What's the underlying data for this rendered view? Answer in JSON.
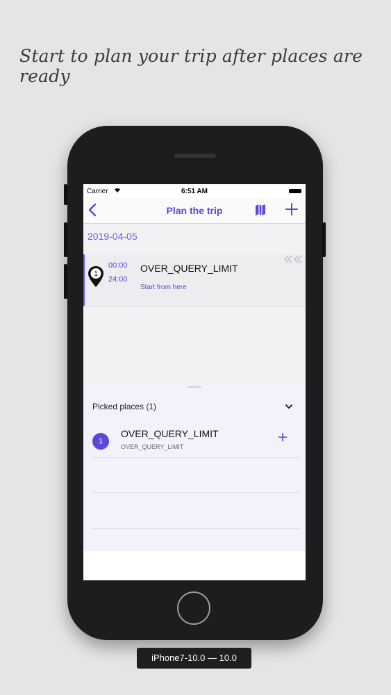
{
  "headline": "Start to plan your trip after places are ready",
  "device_label": "iPhone7-10.0 — 10.0",
  "status_bar": {
    "carrier": "Carrier",
    "time": "6:51 AM"
  },
  "nav": {
    "title": "Plan the trip",
    "back_icon": "chevron-left-icon",
    "map_icon": "map-icon",
    "add_icon": "plus-icon"
  },
  "plan": {
    "date": "2019-04-05",
    "item": {
      "start_time": "00:00",
      "end_time": "24:00",
      "title": "OVER_QUERY_LIMIT",
      "subtitle": "Start from here",
      "pin_number": "1"
    }
  },
  "picked": {
    "header": "Picked places (1)",
    "items": [
      {
        "number": "1",
        "title": "OVER_QUERY_LIMIT",
        "subtitle": "OVER_QUERY_LIMIT"
      }
    ]
  },
  "colors": {
    "accent": "#5a48d6",
    "background": "#e5e4e6",
    "phone": "#1d1d1f"
  }
}
